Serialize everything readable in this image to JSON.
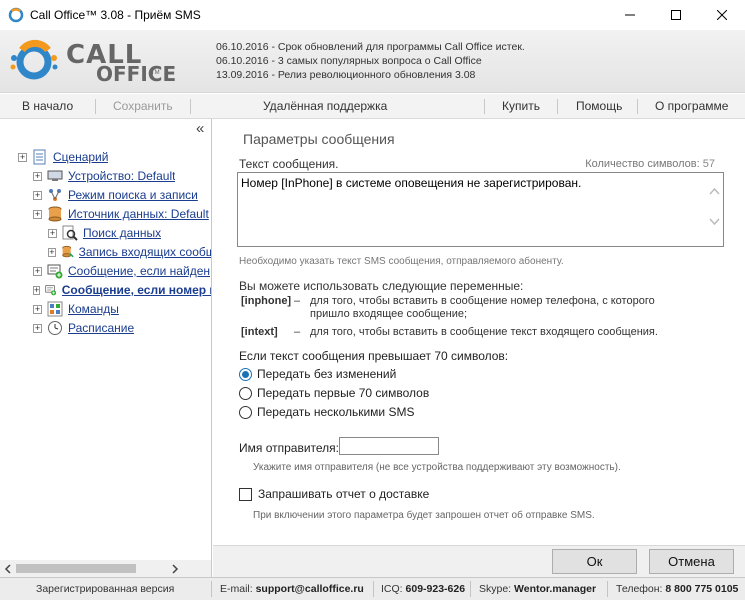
{
  "window": {
    "title": "Call Office™ 3.08 - Приём SMS"
  },
  "header": {
    "logo_line1": "CALL",
    "logo_line2": "OFFICE",
    "logo_tm": "TM",
    "news": [
      "06.10.2016 - Срок обновлений для программы Call Office истек.",
      "06.10.2016 - 3 самых популярных вопроса о Call Office",
      "13.09.2016 - Релиз революционного обновления 3.08"
    ]
  },
  "menu": {
    "home": "В начало",
    "save": "Сохранить",
    "remote": "Удалённая поддержка",
    "buy": "Купить",
    "help": "Помощь",
    "about": "О программе"
  },
  "tree": {
    "collapse_glyph": "«",
    "items": [
      {
        "label": "Сценарий",
        "expander": "+"
      },
      {
        "label": "Устройство: Default",
        "expander": "+"
      },
      {
        "label": "Режим поиска и записи",
        "expander": "+"
      },
      {
        "label": "Источник данных: Default",
        "expander": "+"
      },
      {
        "label": "Поиск данных",
        "expander": "+"
      },
      {
        "label": "Запись входящих сообщений",
        "expander": "+"
      },
      {
        "label": "Сообщение, если найден",
        "expander": "+"
      },
      {
        "label": "Сообщение, если номер не найден",
        "expander": "+"
      },
      {
        "label": "Команды",
        "expander": "+"
      },
      {
        "label": "Расписание",
        "expander": "+"
      }
    ]
  },
  "form": {
    "section_title": "Параметры сообщения",
    "message_label": "Текст сообщения.",
    "charcount_label": "Количество символов:",
    "charcount_value": "57",
    "message_text": "Номер [InPhone] в системе оповещения не зарегистрирован.",
    "message_hint": "Необходимо указать текст SMS сообщения, отправляемого абоненту.",
    "vars_intro": "Вы можете использовать следующие переменные:",
    "vars": [
      {
        "name": "[inphone]",
        "dash": "–",
        "desc": "для того, чтобы вставить в сообщение номер телефона, с которого пришло входящее сообщение;"
      },
      {
        "name": "[intext]",
        "dash": "–",
        "desc": "для того, чтобы вставить в сообщение текст входящего сообщения."
      }
    ],
    "overflow_label": "Если текст сообщения превышает 70 символов:",
    "radio_options": [
      {
        "label": "Передать без изменений",
        "checked": true
      },
      {
        "label": "Передать первые 70 символов",
        "checked": false
      },
      {
        "label": "Передать несколькими SMS",
        "checked": false
      }
    ],
    "sender_label": "Имя отправителя:",
    "sender_value": "",
    "sender_hint": "Укажите имя отправителя (не все устройства поддерживают эту возможность).",
    "delivery_label": "Запрашивать отчет о доставке",
    "delivery_checked": false,
    "delivery_hint": "При включении этого параметра будет запрошен отчет об отправке SMS."
  },
  "buttons": {
    "ok": "Ок",
    "cancel": "Отмена"
  },
  "status": {
    "registered": "Зарегистрированная версия",
    "email_label": "E-mail:",
    "email": "support@calloffice.ru",
    "icq_label": "ICQ:",
    "icq": "609-923-626",
    "skype_label": "Skype:",
    "skype": "Wentor.manager",
    "phone_label": "Телефон:",
    "phone": "8 800 775 0105"
  },
  "colors": {
    "accent_blue": "#1a73b5",
    "link_blue": "#1a3d8f",
    "logo_orange": "#f39a1e"
  }
}
